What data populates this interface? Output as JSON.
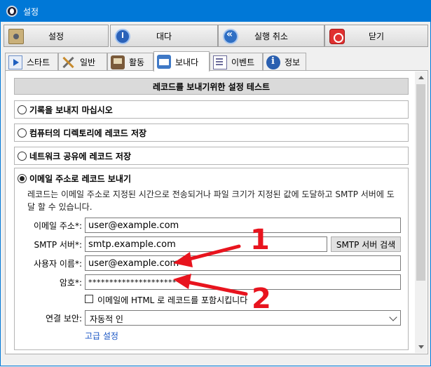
{
  "window": {
    "title": "설정"
  },
  "toolbar": {
    "settings": "설정",
    "wait": "대다",
    "undo": "실행 취소",
    "close": "닫기"
  },
  "tabs": [
    "스타트",
    "일반",
    "활동",
    "보내다",
    "이벤트",
    "정보"
  ],
  "section": {
    "header": "레코드를 보내기위한 설정 테스트"
  },
  "options": {
    "no_send": "기록을 보내지 마십시오",
    "save_dir": "컴퓨터의 디렉토리에 레코드 저장",
    "save_net": "네트워크 공유에 레코드 저장",
    "send_email": "이메일 주소로 레코드 보내기"
  },
  "email": {
    "description": "레코드는 이메일 주소로 지정된 시간으로 전송되거나 파일 크기가 지정된 값에 도달하고 SMTP 서버에 도달 할 수 있습니다.",
    "address_label": "이메일 주소*:",
    "address_value": "user@example.com",
    "smtp_label": "SMTP 서버*:",
    "smtp_value": "smtp.example.com",
    "smtp_button": "SMTP 서버 검색",
    "user_label": "사용자 이름*:",
    "user_value": "user@example.com",
    "password_label": "암호*:",
    "password_value": "**********************",
    "html_checkbox": "이메일에 HTML 로 레코드를 포함시킵니다",
    "html_checked": false,
    "security_label": "연결 보안:",
    "security_value": "자동적 인",
    "advanced_link": "고급 설정"
  },
  "annotations": {
    "one": "1",
    "two": "2",
    "color": "#e8141e"
  }
}
